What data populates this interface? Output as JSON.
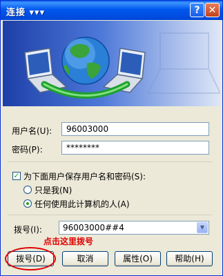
{
  "window": {
    "title": "连接 ▾▾▾",
    "help_glyph": "?",
    "close_glyph": "✕"
  },
  "colors": {
    "title_bar": "#0058ee",
    "hint_text": "#e00000",
    "annotation_oval": "#e00000"
  },
  "form": {
    "username_label": "用户名(U):",
    "username_value": "96003000",
    "password_label": "密码(P):",
    "password_value": "********",
    "save_checkbox_label": "为下面用户保存用户名和密码(S):",
    "save_checked": true,
    "radio_only_me": "只是我(N)",
    "radio_anyone": "任何使用此计算机的人(A)",
    "selected_radio": "anyone",
    "dial_label": "拨号(I):",
    "dial_value": "96003000##4"
  },
  "annotation": {
    "hint": "点击这里拨号"
  },
  "buttons": {
    "dial": "拨号(D)",
    "cancel": "取消",
    "properties": "属性(O)",
    "help": "帮助(H)"
  },
  "icons": [
    "help-icon",
    "close-icon",
    "globe-icon",
    "laptop-icon",
    "checkbox-icon",
    "radio-icon",
    "dropdown-arrow-icon"
  ]
}
